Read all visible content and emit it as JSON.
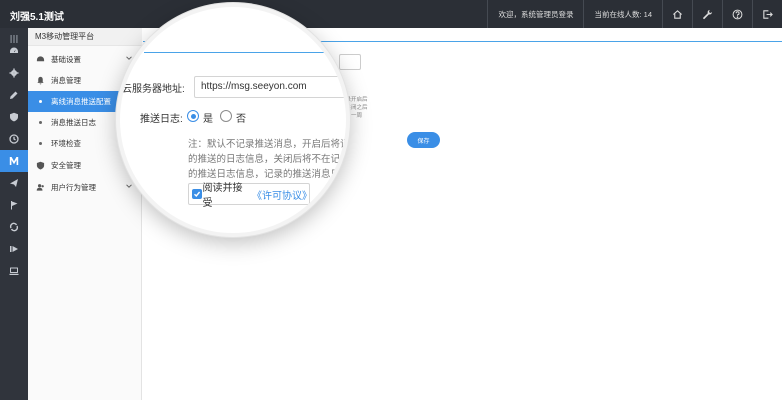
{
  "app": {
    "title": "刘强5.1测试"
  },
  "topbar": {
    "welcome": "欢迎，系统管理员登录",
    "online": "当前在线人数: 14",
    "icons": [
      "home-icon",
      "wrench-icon",
      "help-icon",
      "logout-icon"
    ]
  },
  "rail": {
    "icons": [
      "menu-icon",
      "dashboard-icon",
      "gear-icon",
      "edit-icon",
      "shield-icon",
      "clock-icon",
      "m3-icon",
      "paper-plane-icon",
      "flag-icon",
      "recycle-icon",
      "forward-icon",
      "monitor-icon"
    ]
  },
  "subnav": {
    "title": "M3移动管理平台",
    "items": [
      {
        "label": "基础设置",
        "icon": "dashboard-icon"
      },
      {
        "label": "消息管理",
        "icon": "bell-icon"
      },
      {
        "label": "离线消息推送配置"
      },
      {
        "label": "消息推送日志"
      },
      {
        "label": "环境检查"
      },
      {
        "label": "安全管理",
        "icon": "shield-icon"
      },
      {
        "label": "用户行为管理",
        "icon": "users-icon"
      }
    ]
  },
  "form": {
    "server_label": "云服务器地址:",
    "server_value": "https://msg.seeyon.com",
    "log_label": "推送日志:",
    "opt_yes": "是",
    "opt_no": "否",
    "note_line1": "注：默认不记录推送消息，开启后将记录",
    "note_line2": "的推送的日志信息，关闭后将不在记录",
    "note_line3": "的推送日志信息，记录的推送消息只保",
    "agree_text": "阅读并接受",
    "agree_link": "《许可协议》"
  },
  "background": {
    "note_line1": "记录开启后",
    "note_line2": "录关闭之后",
    "note_line3": "保留一周",
    "save_label": "保存"
  },
  "colors": {
    "accent": "#3a8ee6",
    "topbar": "#2b2f36",
    "rail": "#30343c"
  }
}
